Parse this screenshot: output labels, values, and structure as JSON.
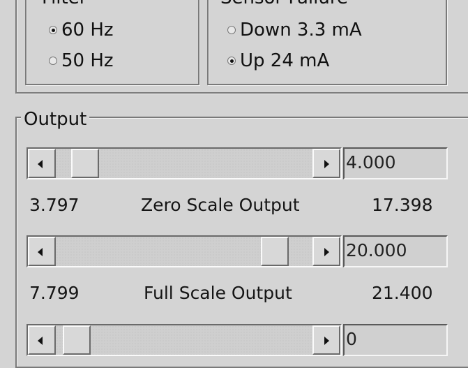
{
  "filter": {
    "legend": "Filter",
    "options": [
      {
        "label": "60 Hz",
        "selected": true
      },
      {
        "label": "50 Hz",
        "selected": false
      }
    ]
  },
  "sensor_failure": {
    "legend": "Sensor Failure",
    "options": [
      {
        "label": "Down 3.3 mA",
        "selected": false
      },
      {
        "label": "Up 24 mA",
        "selected": true
      }
    ]
  },
  "output": {
    "legend": "Output",
    "zero_scale": {
      "min": "3.797",
      "label": "Zero Scale Output",
      "max": "17.398",
      "value": "4.000"
    },
    "full_scale": {
      "min": "7.799",
      "label": "Full Scale Output",
      "max": "21.400",
      "value": "20.000"
    },
    "third": {
      "value": "0"
    }
  }
}
